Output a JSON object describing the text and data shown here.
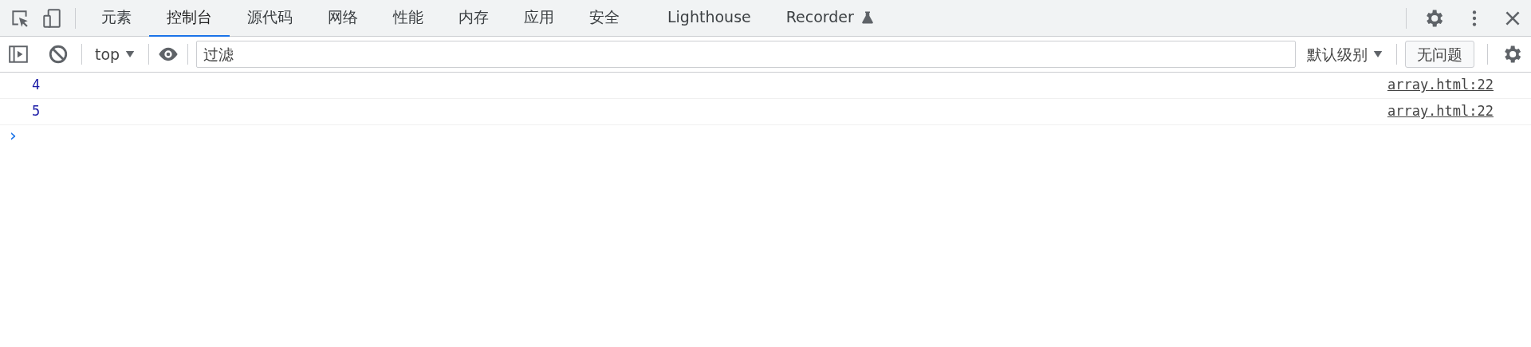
{
  "tabs": [
    {
      "label": "元素",
      "selected": false
    },
    {
      "label": "控制台",
      "selected": true
    },
    {
      "label": "源代码",
      "selected": false
    },
    {
      "label": "网络",
      "selected": false
    },
    {
      "label": "性能",
      "selected": false
    },
    {
      "label": "内存",
      "selected": false
    },
    {
      "label": "应用",
      "selected": false
    },
    {
      "label": "安全",
      "selected": false
    },
    {
      "label": "Lighthouse",
      "selected": false,
      "gap": true
    },
    {
      "label": "Recorder",
      "selected": false,
      "experimental": true
    }
  ],
  "toolbar": {
    "context": "top",
    "filter": {
      "placeholder": "过滤"
    },
    "level": "默认级别",
    "issues": "无问题"
  },
  "messages": [
    {
      "text": "4",
      "source": "array.html:22"
    },
    {
      "text": "5",
      "source": "array.html:22"
    }
  ],
  "prompt": "›"
}
